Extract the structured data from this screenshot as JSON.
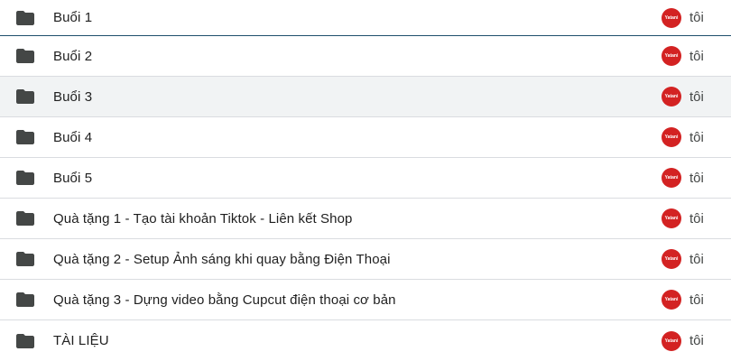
{
  "icons": {
    "folder": "folder-icon",
    "avatar": "owner-avatar"
  },
  "colors": {
    "folder": "#444746",
    "avatar_bg": "#d32222",
    "hover_row": "#f1f3f4"
  },
  "avatar_text": "Yatani",
  "rows": [
    {
      "name": "Buổi 1",
      "owner": "tôi"
    },
    {
      "name": "Buổi 2",
      "owner": "tôi"
    },
    {
      "name": "Buổi 3",
      "owner": "tôi"
    },
    {
      "name": "Buổi 4",
      "owner": "tôi"
    },
    {
      "name": "Buổi 5",
      "owner": "tôi"
    },
    {
      "name": "Quà tặng 1 - Tạo tài khoản Tiktok - Liên kết Shop",
      "owner": "tôi"
    },
    {
      "name": "Quà tặng 2 - Setup Ảnh sáng khi quay bằng Điện Thoại",
      "owner": "tôi"
    },
    {
      "name": "Quà tặng 3 - Dựng video bằng Cupcut điện thoại cơ bản",
      "owner": "tôi"
    },
    {
      "name": "TÀI LIỆU",
      "owner": "tôi"
    }
  ]
}
